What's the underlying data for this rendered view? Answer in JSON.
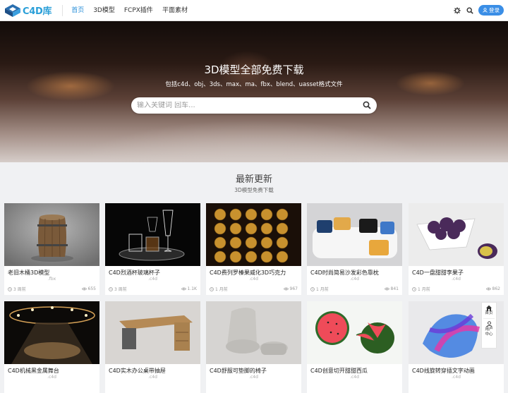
{
  "header": {
    "logo_text": "C4D库",
    "nav": [
      "首页",
      "3D模型",
      "FCPX插件",
      "平面素材"
    ],
    "login_label": "登录"
  },
  "hero": {
    "title": "3D模型全部免费下载",
    "subtitle": "包括c4d、obj、3ds、max、ma、fbx、blend、uasset格式文件",
    "search_placeholder": "输入关键词 回车..."
  },
  "section": {
    "title": "最新更新",
    "subtitle": "3D模型免费下载"
  },
  "cards": [
    {
      "title": "老旧木桶3D模型",
      "ext": ".fbx",
      "time": "3 周前",
      "views": "655"
    },
    {
      "title": "C4D烈酒杯玻璃杯子",
      "ext": ".c4d",
      "time": "3 周前",
      "views": "1.1K"
    },
    {
      "title": "C4D费列罗榛果威化3D巧克力",
      "ext": ".c4d",
      "time": "1 月前",
      "views": "967"
    },
    {
      "title": "C4D时尚简易沙发彩色靠枕",
      "ext": ".c4d",
      "time": "1 月前",
      "views": "841"
    },
    {
      "title": "C4D一盘甜甜李果子",
      "ext": ".c4d",
      "time": "1 月前",
      "views": "862"
    },
    {
      "title": "C4D机械黑金属舞台",
      "ext": ".c4d",
      "time": "",
      "views": ""
    },
    {
      "title": "C4D实木办公桌带抽屉",
      "ext": ".c4d",
      "time": "",
      "views": ""
    },
    {
      "title": "C4D舒服可垫脚的椅子",
      "ext": ".c4d",
      "time": "",
      "views": ""
    },
    {
      "title": "C4D创意切开甜甜西瓜",
      "ext": ".c4d",
      "time": "",
      "views": ""
    },
    {
      "title": "C4D线旋转穿插文字动画",
      "ext": ".c4d",
      "time": "",
      "views": ""
    }
  ],
  "float_bar": {
    "home_label": "首页",
    "user_label": "用户中心"
  },
  "colors": {
    "accent": "#3a8ee6",
    "logo": "#2a9fd8",
    "nav_active": "#2a8fd8"
  },
  "icons": [
    "logo-cube-icon",
    "settings-icon",
    "search-icon",
    "user-icon",
    "clock-icon",
    "eye-icon",
    "home-icon"
  ]
}
